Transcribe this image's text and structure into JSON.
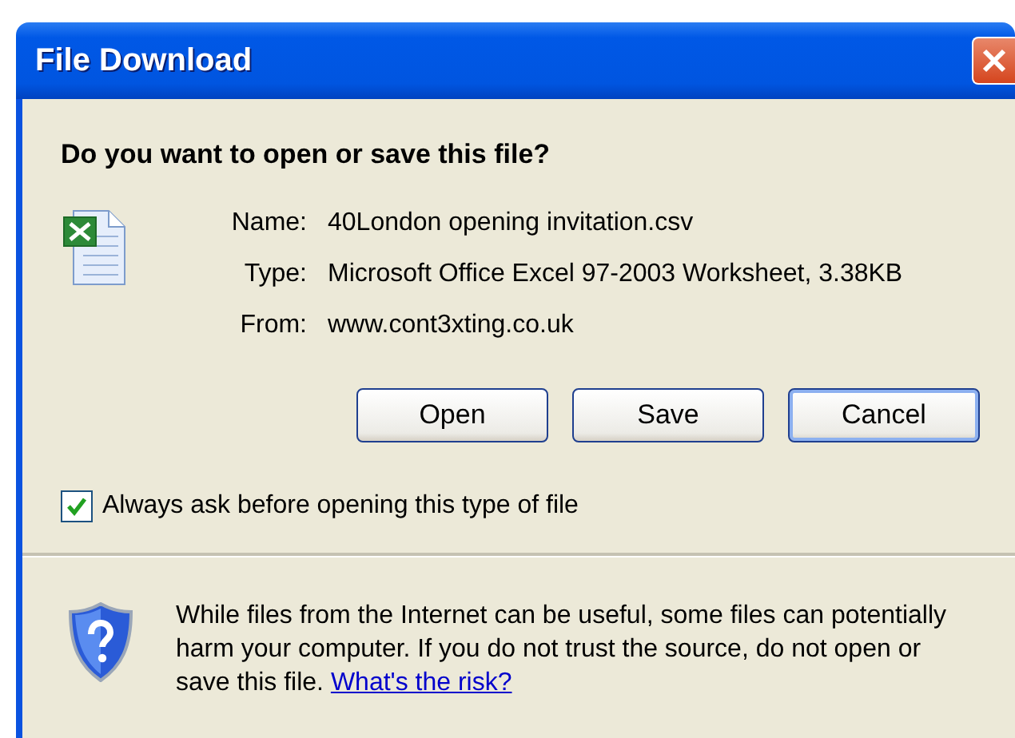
{
  "window": {
    "title": "File Download"
  },
  "question": "Do you want to open or save this file?",
  "file_info": [
    {
      "label": "Name:",
      "value": "40London opening invitation.csv"
    },
    {
      "label": "Type:",
      "value": "Microsoft Office Excel 97-2003 Worksheet, 3.38KB"
    },
    {
      "label": "From:",
      "value": "www.cont3xting.co.uk"
    }
  ],
  "buttons": [
    {
      "label": "Open",
      "default": false
    },
    {
      "label": "Save",
      "default": false
    },
    {
      "label": "Cancel",
      "default": true
    }
  ],
  "always_ask": {
    "label": "Always ask before opening this type of file",
    "checked": true
  },
  "warning": {
    "text": "While files from the Internet can be useful, some files can potentially harm your computer. If you do not trust the source, do not open or save this file.",
    "link": "What's the risk?"
  }
}
